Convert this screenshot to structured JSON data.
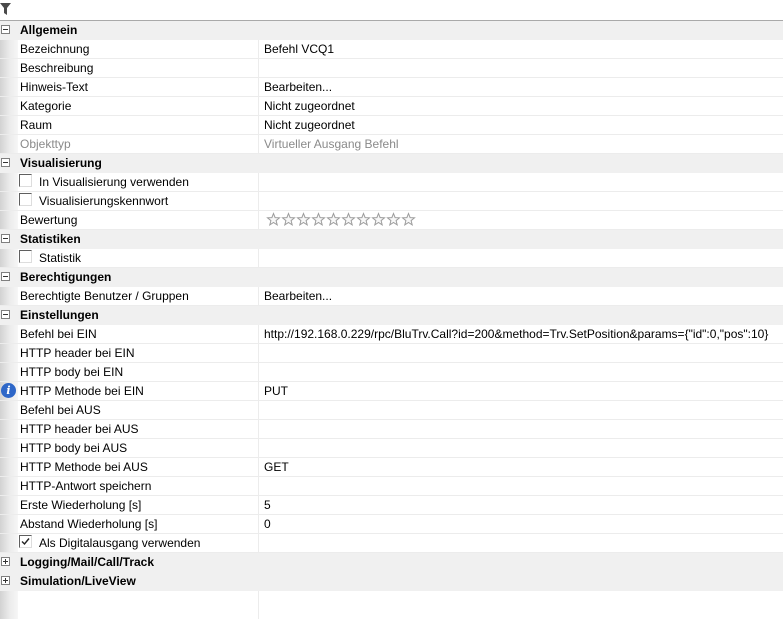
{
  "colors": {
    "category_bg": "#f0f0f0",
    "grid_line": "#ececec",
    "readonly_text": "#8a8a8a",
    "info_icon": "#2e67c8",
    "star_outline": "#9c9c9c"
  },
  "toolbar": {
    "icon": "filter-icon"
  },
  "sections": {
    "allgemein": {
      "label": "Allgemein",
      "bezeichnung": {
        "name": "Bezeichnung",
        "value": "Befehl VCQ1"
      },
      "beschreibung": {
        "name": "Beschreibung",
        "value": ""
      },
      "hinweis_text": {
        "name": "Hinweis-Text",
        "value": "Bearbeiten..."
      },
      "kategorie": {
        "name": "Kategorie",
        "value": "Nicht zugeordnet"
      },
      "raum": {
        "name": "Raum",
        "value": "Nicht zugeordnet"
      },
      "objekttyp": {
        "name": "Objekttyp",
        "value": "Virtueller Ausgang Befehl"
      }
    },
    "visualisierung": {
      "label": "Visualisierung",
      "in_visualisierung": {
        "name": "In Visualisierung verwenden",
        "checked": false
      },
      "kennwort": {
        "name": "Visualisierungskennwort",
        "checked": false
      },
      "bewertung": {
        "name": "Bewertung",
        "stars_total": 10,
        "stars_filled": 0
      }
    },
    "statistiken": {
      "label": "Statistiken",
      "statistik": {
        "name": "Statistik",
        "checked": false
      }
    },
    "berechtigungen": {
      "label": "Berechtigungen",
      "benutzer": {
        "name": "Berechtigte Benutzer / Gruppen",
        "value": "Bearbeiten..."
      }
    },
    "einstellungen": {
      "label": "Einstellungen",
      "befehl_ein": {
        "name": "Befehl bei EIN",
        "value": "http://192.168.0.229/rpc/BluTrv.Call?id=200&method=Trv.SetPosition&params={\"id\":0,\"pos\":10}"
      },
      "header_ein": {
        "name": "HTTP header bei EIN",
        "value": ""
      },
      "body_ein": {
        "name": "HTTP body bei EIN",
        "value": ""
      },
      "methode_ein": {
        "name": "HTTP Methode bei EIN",
        "value": "PUT",
        "icon": "info-icon"
      },
      "befehl_aus": {
        "name": "Befehl bei AUS",
        "value": ""
      },
      "header_aus": {
        "name": "HTTP header bei AUS",
        "value": ""
      },
      "body_aus": {
        "name": "HTTP body bei AUS",
        "value": ""
      },
      "methode_aus": {
        "name": "HTTP Methode bei AUS",
        "value": "GET"
      },
      "antwort_speichern": {
        "name": "HTTP-Antwort speichern",
        "value": ""
      },
      "erste_wiederholung": {
        "name": "Erste Wiederholung [s]",
        "value": "5"
      },
      "abstand_wiederholung": {
        "name": "Abstand Wiederholung [s]",
        "value": "0"
      },
      "digitalausgang": {
        "name": "Als Digitalausgang verwenden",
        "checked": true
      }
    },
    "logging": {
      "label": "Logging/Mail/Call/Track"
    },
    "simulation": {
      "label": "Simulation/LiveView"
    }
  }
}
